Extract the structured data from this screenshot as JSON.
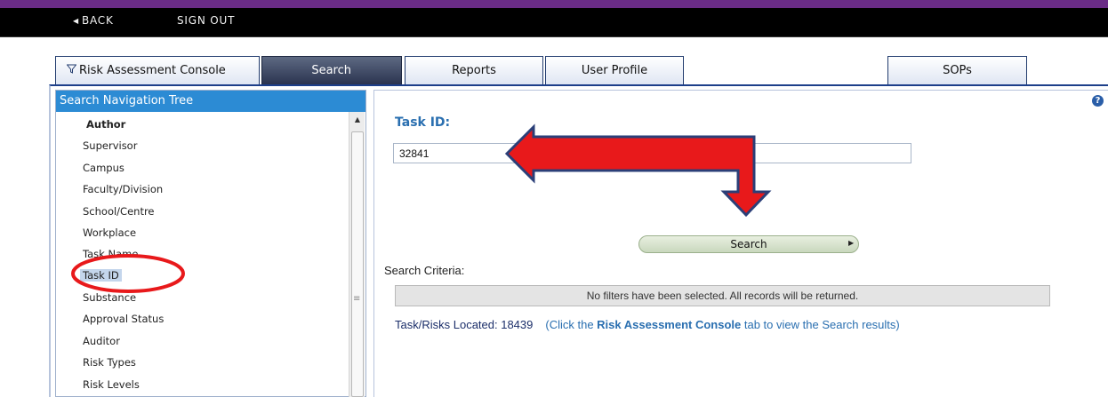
{
  "topbar": {
    "back_label": "BACK",
    "signout_label": "SIGN OUT"
  },
  "tabs": [
    {
      "label": "Risk Assessment Console",
      "icon": "filter-icon",
      "active": false
    },
    {
      "label": "Search",
      "active": true
    },
    {
      "label": "Reports",
      "active": false
    },
    {
      "label": "User Profile",
      "active": false
    },
    {
      "label": "SOPs",
      "active": false
    }
  ],
  "nav": {
    "header": "Search Navigation Tree",
    "items": [
      "Author",
      "Supervisor",
      "Campus",
      "Faculty/Division",
      "School/Centre",
      "Workplace",
      "Task Name",
      "Task ID",
      "Substance",
      "Approval Status",
      "Auditor",
      "Risk Types",
      "Risk Levels"
    ],
    "selected": "Task ID"
  },
  "main": {
    "field_label": "Task ID:",
    "task_id_value": "32841",
    "search_button": "Search",
    "criteria_label": "Search Criteria:",
    "criteria_message": "No filters have been selected. All records will be returned.",
    "results_label": "Task/Risks Located: 18439",
    "results_hint_prefix": "(Click the ",
    "results_hint_bold": "Risk Assessment Console",
    "results_hint_suffix": " tab to view the Search results)"
  },
  "colors": {
    "accent_purple": "#6a2c86",
    "nav_header_blue": "#2c8bd4",
    "label_blue": "#2a6fb0",
    "annotation_red": "#e8191b",
    "annotation_outline": "#2b3f78"
  },
  "icons": {
    "back": "caret-left-icon",
    "help": "help-icon",
    "filter": "filter-icon"
  }
}
